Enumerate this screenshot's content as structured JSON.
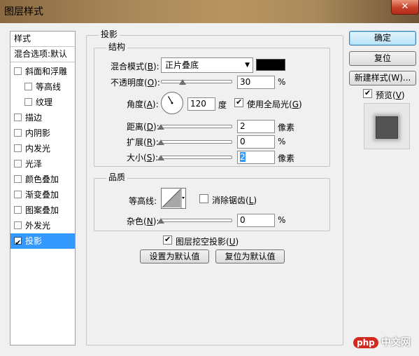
{
  "window": {
    "title": "图层样式",
    "close_label": "✕"
  },
  "style_list": {
    "header": "样式",
    "blend_options": "混合选项:默认",
    "items": [
      {
        "label": "斜面和浮雕",
        "checked": false,
        "sub": false
      },
      {
        "label": "等高线",
        "checked": false,
        "sub": true
      },
      {
        "label": "纹理",
        "checked": false,
        "sub": true
      },
      {
        "label": "描边",
        "checked": false,
        "sub": false
      },
      {
        "label": "内阴影",
        "checked": false,
        "sub": false
      },
      {
        "label": "内发光",
        "checked": false,
        "sub": false
      },
      {
        "label": "光泽",
        "checked": false,
        "sub": false
      },
      {
        "label": "颜色叠加",
        "checked": false,
        "sub": false
      },
      {
        "label": "渐变叠加",
        "checked": false,
        "sub": false
      },
      {
        "label": "图案叠加",
        "checked": false,
        "sub": false
      },
      {
        "label": "外发光",
        "checked": false,
        "sub": false
      },
      {
        "label": "投影",
        "checked": true,
        "sub": false,
        "selected": true
      }
    ]
  },
  "drop_shadow": {
    "title": "投影",
    "structure": {
      "title": "结构",
      "blend_mode": {
        "label": "混合模式",
        "key": "B",
        "value": "正片叠底",
        "color": "#000000"
      },
      "opacity": {
        "label": "不透明度",
        "key": "O",
        "value": "30",
        "unit": "%",
        "slider_fraction": 0.3
      },
      "angle": {
        "label": "角度",
        "key": "A",
        "value": "120",
        "unit": "度",
        "degrees": 120
      },
      "global_light": {
        "label": "使用全局光",
        "key": "G",
        "checked": true
      },
      "distance": {
        "label": "距离",
        "key": "D",
        "value": "2",
        "unit": "像素",
        "slider_fraction": 0.0
      },
      "spread": {
        "label": "扩展",
        "key": "R",
        "value": "0",
        "unit": "%",
        "slider_fraction": 0.0
      },
      "size": {
        "label": "大小",
        "key": "S",
        "value": "2",
        "unit": "像素",
        "slider_fraction": 0.0
      }
    },
    "quality": {
      "title": "品质",
      "contour": {
        "label": "等高线"
      },
      "anti_alias": {
        "label": "消除锯齿",
        "key": "L",
        "checked": false
      },
      "noise": {
        "label": "杂色",
        "key": "N",
        "value": "0",
        "unit": "%",
        "slider_fraction": 0.0
      }
    },
    "knockout": {
      "label": "图层挖空投影",
      "key": "U",
      "checked": true
    },
    "make_default": "设置为默认值",
    "reset_default": "复位为默认值"
  },
  "buttons": {
    "ok": "确定",
    "reset": "复位",
    "new_style": "新建样式(W)...",
    "preview": {
      "label": "预览",
      "key": "V",
      "checked": true
    }
  },
  "watermark": {
    "brand": "php",
    "text": "中文网"
  }
}
